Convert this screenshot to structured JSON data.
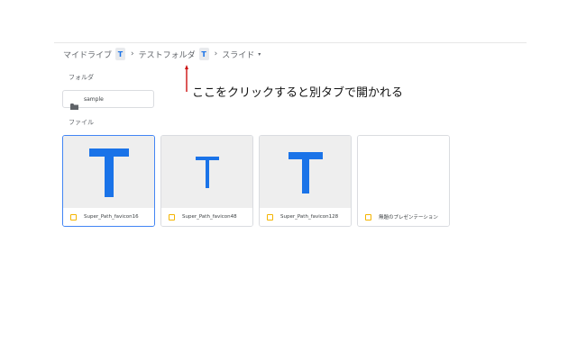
{
  "breadcrumb": {
    "my_drive": "マイドライブ",
    "badge_1": "T",
    "sep_1": "›",
    "test_folder": "テストフォルダ",
    "badge_2": "T",
    "sep_2": "›",
    "current": "スライド",
    "current_caret": "▾"
  },
  "sections": {
    "folders_label": "フォルダ",
    "files_label": "ファイル"
  },
  "folders": [
    {
      "name": "sample",
      "icon": "folder-icon"
    }
  ],
  "annotation": {
    "text": "ここをクリックすると別タブで開かれる",
    "arrow_color": "#cc1111"
  },
  "files": [
    {
      "name": "Super_Path_favicon16",
      "thumb_letter": "T",
      "icon": "slides-icon"
    },
    {
      "name": "Super_Path_favicon48",
      "thumb_letter": "T",
      "icon": "slides-icon"
    },
    {
      "name": "Super_Path_favicon128",
      "thumb_letter": "T",
      "icon": "slides-icon"
    },
    {
      "name": "無題のプレゼンテーション",
      "thumb_letter": "",
      "icon": "slides-icon"
    }
  ],
  "colors": {
    "brand_blue": "#1a73e8",
    "slides_yellow": "#f4b400",
    "selection_border": "#4285f4"
  }
}
